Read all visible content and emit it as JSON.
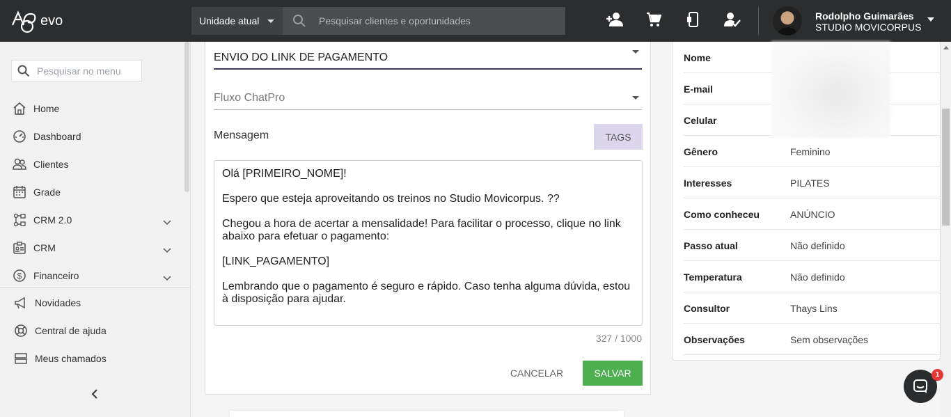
{
  "brand": {
    "logo_text": "evo"
  },
  "topbar": {
    "unit_select": "Unidade atual",
    "search_placeholder": "Pesquisar clientes e oportunidades",
    "user_name": "Rodolpho Guimarães",
    "user_studio": "STUDIO MOVICORPUS",
    "icons": [
      "add-user-icon",
      "cart-icon",
      "phone-icon",
      "user-check-icon"
    ]
  },
  "sidebar": {
    "search_placeholder": "Pesquisar no menu",
    "items": [
      {
        "label": "Home",
        "icon": "home-icon",
        "expandable": false
      },
      {
        "label": "Dashboard",
        "icon": "dashboard-icon",
        "expandable": false
      },
      {
        "label": "Clientes",
        "icon": "clients-icon",
        "expandable": false
      },
      {
        "label": "Grade",
        "icon": "calendar-icon",
        "expandable": false
      },
      {
        "label": "CRM 2.0",
        "icon": "crm-flow-icon",
        "expandable": true
      },
      {
        "label": "CRM",
        "icon": "id-card-icon",
        "expandable": true
      },
      {
        "label": "Financeiro",
        "icon": "dollar-icon",
        "expandable": true
      }
    ],
    "footer_items": [
      {
        "label": "Novidades",
        "icon": "megaphone-icon"
      },
      {
        "label": "Central de ajuda",
        "icon": "lifebuoy-icon"
      },
      {
        "label": "Meus chamados",
        "icon": "tickets-icon"
      }
    ]
  },
  "form": {
    "template_value": "ENVIO DO LINK DE PAGAMENTO",
    "flow_placeholder": "Fluxo ChatPro",
    "message_label": "Mensagem",
    "tags_label": "TAGS",
    "message_text": "Olá [PRIMEIRO_NOME]!\n\nEspero que esteja aproveitando os treinos no Studio Movicorpus. ??\n\nChegou a hora de acertar a mensalidade! Para facilitar o processo, clique no link abaixo para efetuar o pagamento:\n\n[LINK_PAGAMENTO]\n\nLembrando que o pagamento é seguro e rápido. Caso tenha alguma dúvida, estou à disposição para ajudar.",
    "counter": "327 / 1000",
    "cancel_label": "CANCELAR",
    "save_label": "SALVAR"
  },
  "info": {
    "rows": [
      {
        "key": "Nome",
        "value": ""
      },
      {
        "key": "E-mail",
        "value": ""
      },
      {
        "key": "Celular",
        "value": ""
      },
      {
        "key": "Gênero",
        "value": "Feminino"
      },
      {
        "key": "Interesses",
        "value": "PILATES"
      },
      {
        "key": "Como conheceu",
        "value": "ANÚNCIO"
      },
      {
        "key": "Passo atual",
        "value": "Não definido"
      },
      {
        "key": "Temperatura",
        "value": "Não definido"
      },
      {
        "key": "Consultor",
        "value": "Thays Lins"
      },
      {
        "key": "Observações",
        "value": "Sem observações"
      }
    ]
  },
  "chat": {
    "badge": "1"
  },
  "colors": {
    "topbar": "#2b2d2f",
    "save": "#4caf50",
    "tags": "#dcd6ec",
    "badge": "#e53935"
  }
}
